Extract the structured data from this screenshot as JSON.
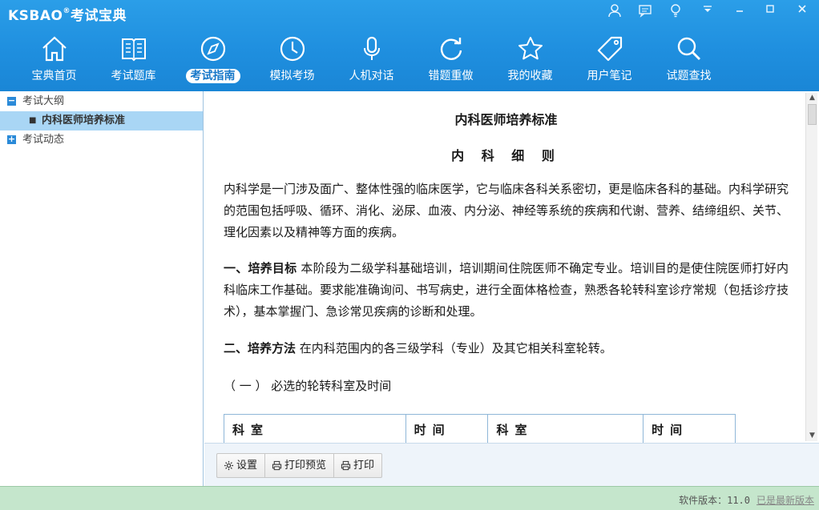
{
  "app": {
    "brand": "KSBAO",
    "brand_mark": "®",
    "brand_cn": "考试宝典"
  },
  "nav": [
    {
      "label": "宝典首页",
      "icon": "home-icon"
    },
    {
      "label": "考试题库",
      "icon": "book-icon"
    },
    {
      "label": "考试指南",
      "icon": "compass-icon",
      "active": true
    },
    {
      "label": "模拟考场",
      "icon": "clock-icon"
    },
    {
      "label": "人机对话",
      "icon": "microphone-icon"
    },
    {
      "label": "错题重做",
      "icon": "refresh-icon"
    },
    {
      "label": "我的收藏",
      "icon": "star-icon"
    },
    {
      "label": "用户笔记",
      "icon": "tag-icon"
    },
    {
      "label": "试题查找",
      "icon": "search-icon"
    }
  ],
  "sidebar": {
    "items": [
      {
        "label": "考试大纲",
        "toggle": "−",
        "expanded": true
      },
      {
        "label": "内科医师培养标准",
        "selected": true
      },
      {
        "label": "考试动态",
        "toggle": "+",
        "expanded": false
      }
    ]
  },
  "document": {
    "title": "内科医师培养标准",
    "subtitle": "内 科 细 则",
    "intro": "内科学是一门涉及面广、整体性强的临床医学，它与临床各科关系密切，更是临床各科的基础。内科学研究的范围包括呼吸、循环、消化、泌尿、血液、内分泌、神经等系统的疾病和代谢、营养、结缔组织、关节、理化因素以及精神等方面的疾病。",
    "section1_heading": "一、培养目标",
    "section1_text": "本阶段为二级学科基础培训，培训期间住院医师不确定专业。培训目的是使住院医师打好内科临床工作基础。要求能准确询问、书写病史，进行全面体格检查，熟悉各轮转科室诊疗常规（包括诊疗技术），基本掌握门、急诊常见疾病的诊断和处理。",
    "section2_heading": "二、培养方法",
    "section2_text": "在内科范围内的各三级学科（专业）及其它相关科室轮转。",
    "subsection": "（ 一 ） 必选的轮转科室及时间",
    "table_headers": [
      "科室",
      "时间",
      "科室",
      "时间"
    ]
  },
  "toolbar": {
    "settings": "设置",
    "print_preview": "打印预览",
    "print": "打印"
  },
  "status": {
    "version_label": "软件版本：",
    "version": "11.0",
    "latest_link": "已是最新版本"
  },
  "colors": {
    "header": "#1f8fdf",
    "selection": "#a9d6f5",
    "status_bar": "#c5e6cc"
  }
}
